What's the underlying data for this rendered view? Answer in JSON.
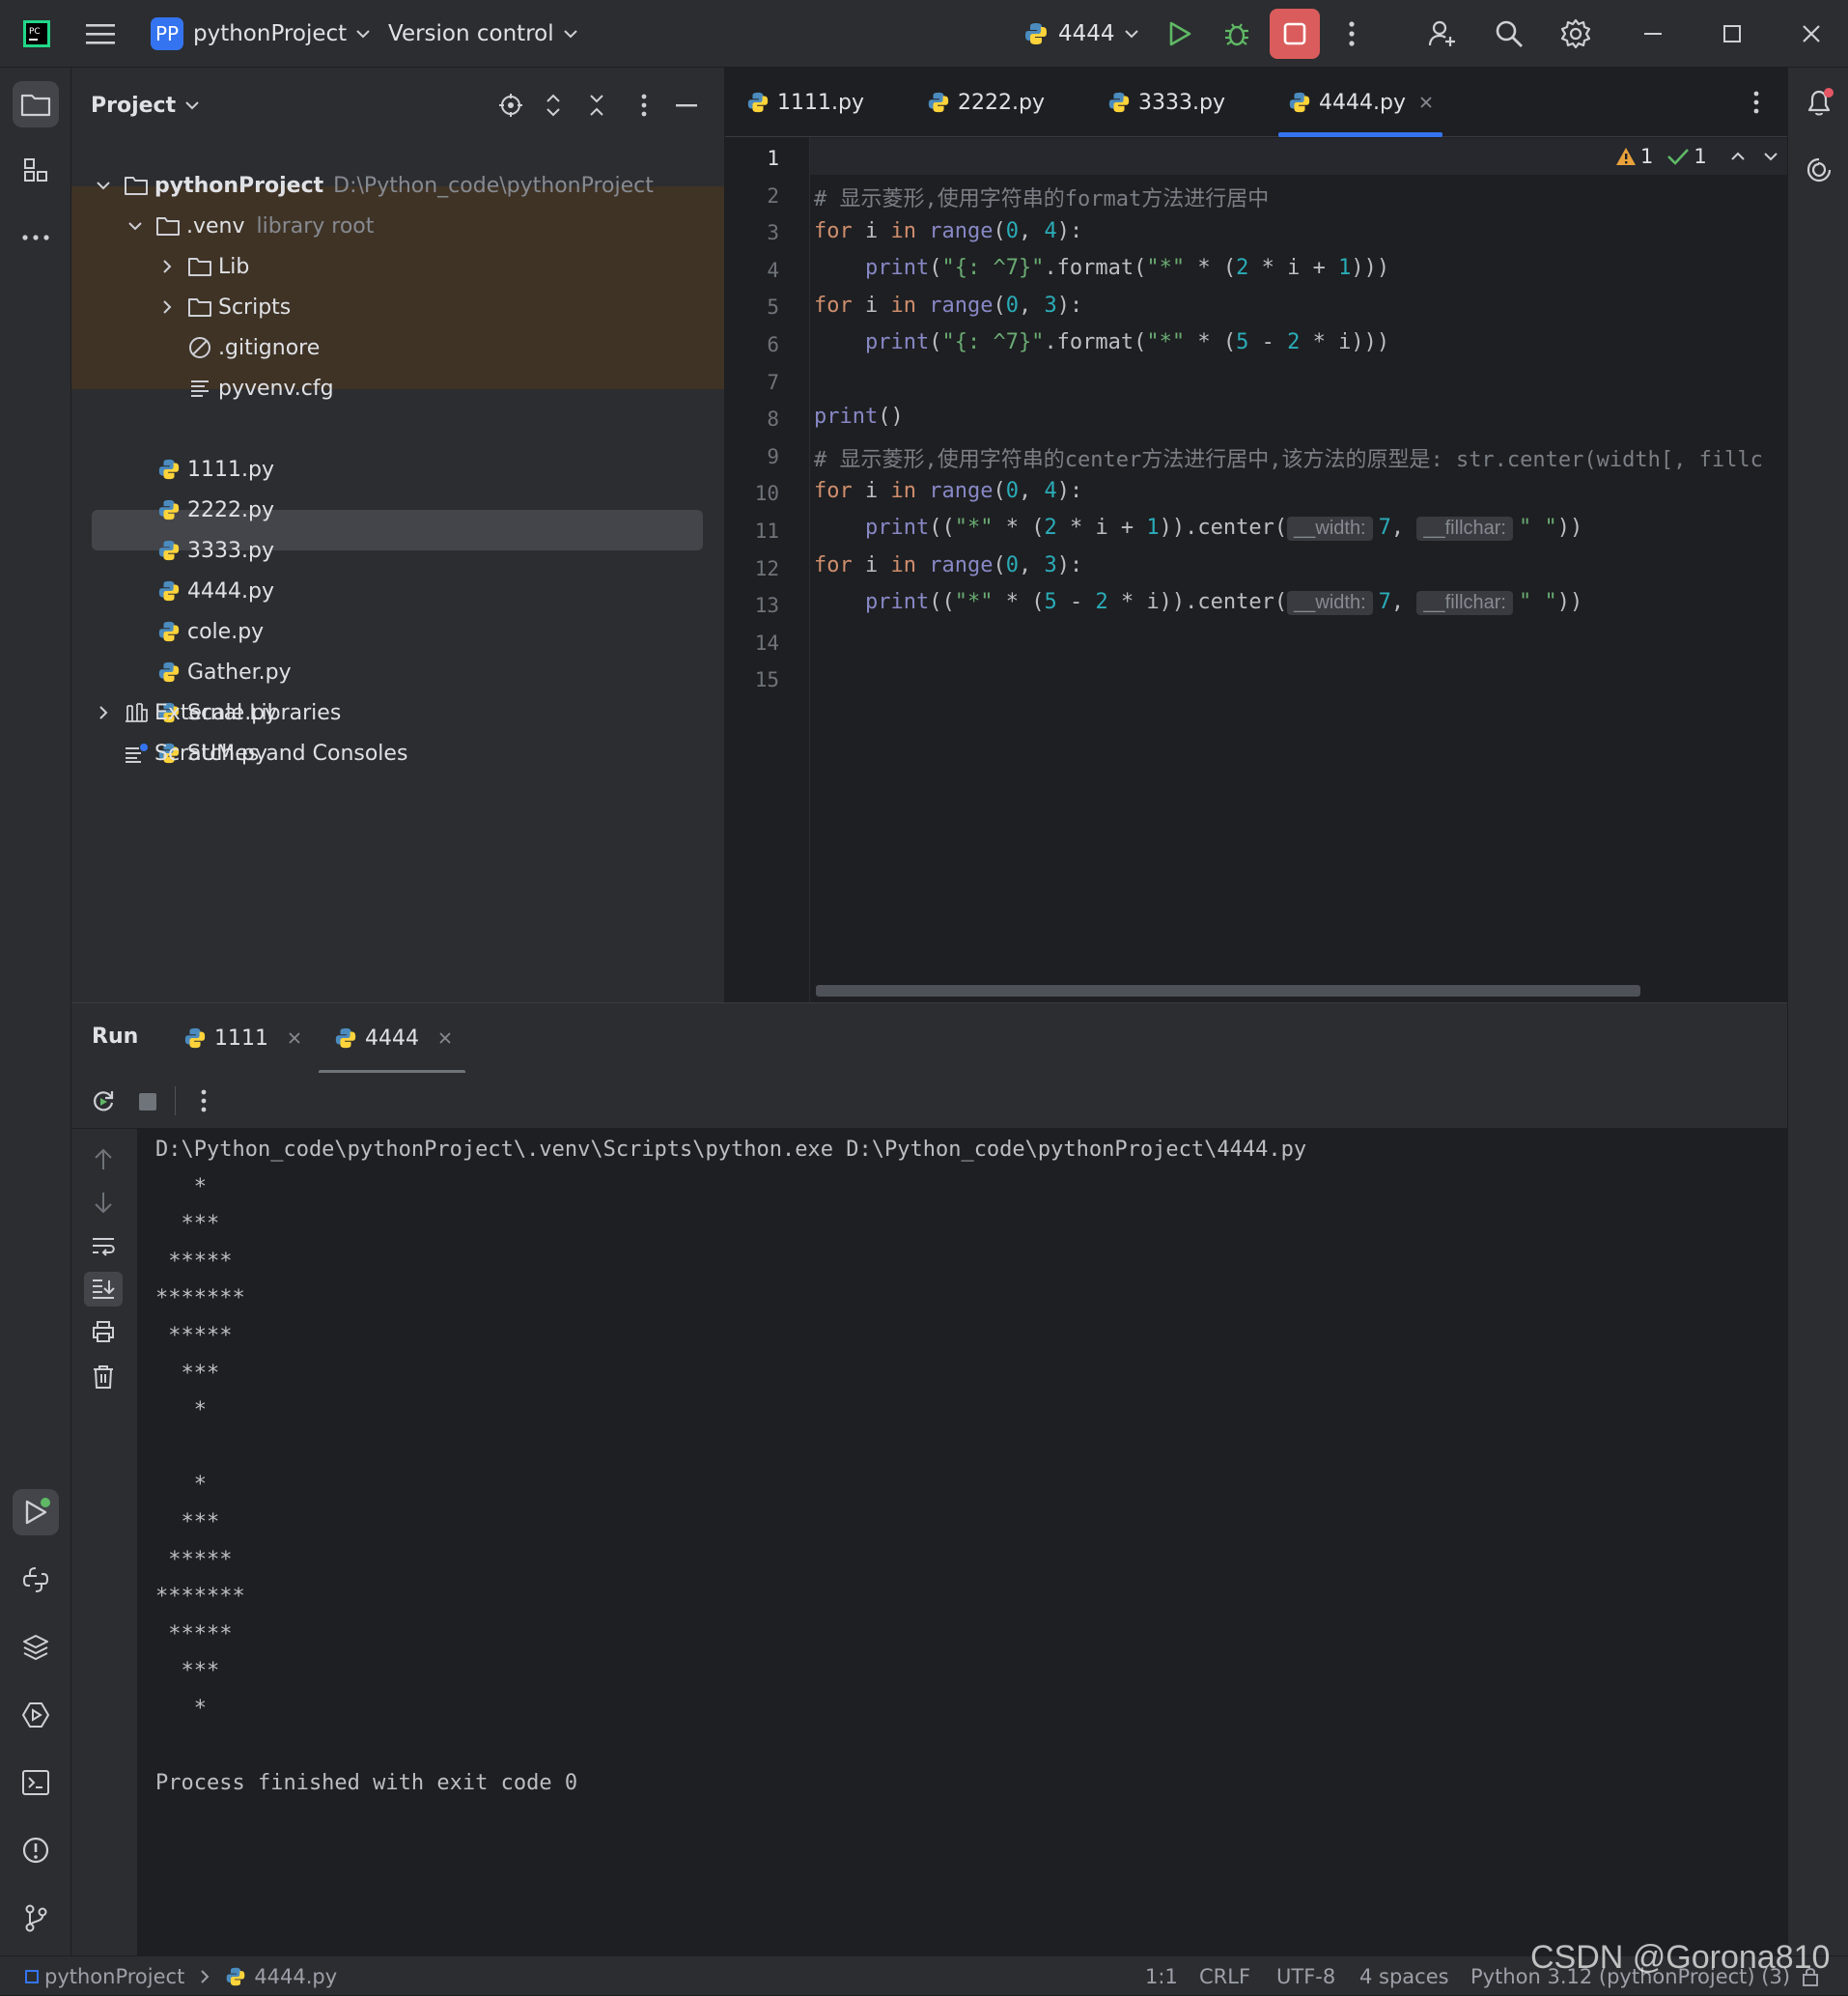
{
  "titlebar": {
    "app_badge": "PP",
    "project_name": "pythonProject",
    "vcs_label": "Version control",
    "run_config": "4444"
  },
  "project_panel": {
    "title": "Project",
    "root": {
      "name": "pythonProject",
      "path": "D:\\Python_code\\pythonProject"
    },
    "venv": {
      "name": ".venv",
      "note": "library root"
    },
    "venv_children": [
      "Lib",
      "Scripts",
      ".gitignore",
      "pyvenv.cfg"
    ],
    "files": [
      "1111.py",
      "2222.py",
      "3333.py",
      "4444.py",
      "cole.py",
      "Gather.py",
      "Scale.py",
      "SUM.py"
    ],
    "selected_file": "4444.py",
    "external_libraries": "External Libraries",
    "scratches": "Scratches and Consoles"
  },
  "editor": {
    "tabs": [
      "1111.py",
      "2222.py",
      "3333.py",
      "4444.py"
    ],
    "active_tab": "4444.py",
    "inspection": {
      "warnings": "1",
      "ok": "1"
    },
    "line_numbers": [
      "1",
      "2",
      "3",
      "4",
      "5",
      "6",
      "7",
      "8",
      "9",
      "10",
      "11",
      "12",
      "13",
      "14",
      "15"
    ],
    "hints": {
      "width": "__width:",
      "fillchar": "__fillchar:"
    },
    "comment1": "# 显示菱形,使用字符串的format方法进行居中",
    "comment2": "# 显示菱形,使用字符串的center方法进行居中,该方法的原型是: str.center(width[, fillc"
  },
  "run_panel": {
    "title": "Run",
    "tabs": [
      "1111",
      "4444"
    ],
    "active_tab": "4444",
    "output": [
      "D:\\Python_code\\pythonProject\\.venv\\Scripts\\python.exe D:\\Python_code\\pythonProject\\4444.py",
      "   *",
      "  ***",
      " *****",
      "*******",
      " *****",
      "  ***",
      "   *",
      "",
      "   *",
      "  ***",
      " *****",
      "*******",
      " *****",
      "  ***",
      "   *",
      "",
      "Process finished with exit code 0"
    ]
  },
  "statusbar": {
    "breadcrumb_project": "pythonProject",
    "breadcrumb_file": "4444.py",
    "position": "1:1",
    "line_sep": "CRLF",
    "encoding": "UTF-8",
    "indent": "4 spaces",
    "interpreter": "Python 3.12 (pythonProject) (3)",
    "watermark": "CSDN @Gorona810"
  },
  "colors": {
    "bg": "#1e1f22",
    "panel": "#2b2d30",
    "accent": "#3574f0",
    "stop_button": "#db5c5c",
    "run_green": "#5fb865",
    "venv_highlight": "#3f3326",
    "selection": "#43454a"
  }
}
